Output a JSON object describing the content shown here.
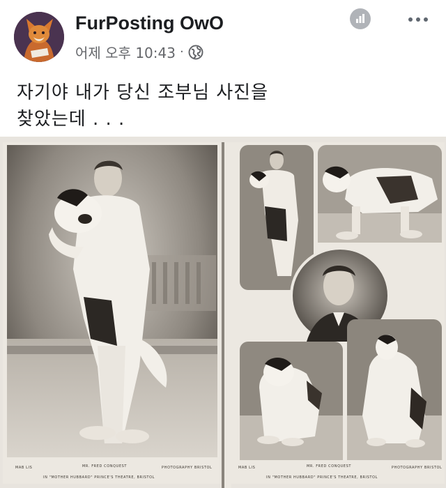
{
  "post": {
    "page_name": "FurPosting OwO",
    "timestamp": "어제 오후 10:43",
    "separator": "·",
    "audience_icon": "globe-icon",
    "stats_icon": "bar-chart-icon",
    "menu_icon": "more-dots-icon",
    "text_lines": [
      "자기야  내가  당신  조부님  사진을",
      "찾았는데 . . ."
    ]
  },
  "photo": {
    "left_card": {
      "caption_left": "MAB LIS",
      "caption_title": "MR. FRED CONQUEST",
      "caption_right": "PHOTOGRAPHY BRISTOL",
      "caption_sub": "IN \"MOTHER HUBBARD\" PRINCE'S THEATRE, BRISTOL"
    },
    "right_card": {
      "caption_left": "MAB LIS",
      "caption_title": "MR. FRED CONQUEST",
      "caption_right": "PHOTOGRAPHY BRISTOL",
      "caption_sub": "IN \"MOTHER HUBBARD\" PRINCE'S THEATRE, BRISTOL"
    }
  },
  "colors": {
    "text": "#1c1e21",
    "meta": "#65676b",
    "icon_gray": "#b0b3b8",
    "sepia": "#9a938a"
  }
}
